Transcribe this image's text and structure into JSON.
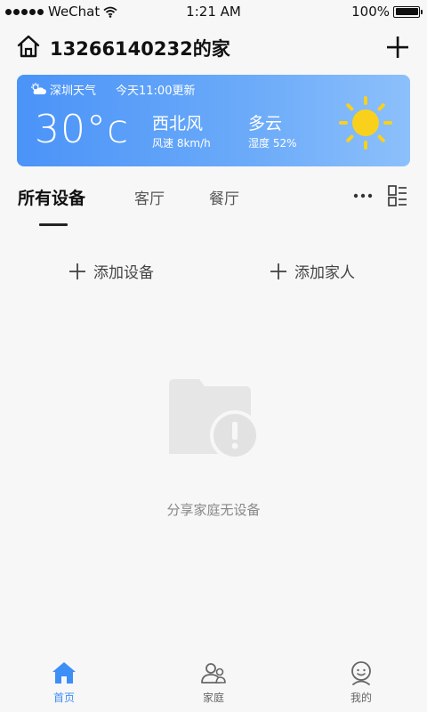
{
  "status_bar": {
    "carrier": "WeChat",
    "time": "1:21 AM",
    "battery_text": "100%",
    "icons": [
      "signal-dots-icon",
      "wifi-icon",
      "battery-icon"
    ]
  },
  "header": {
    "title": "13266140232的家",
    "home_icon": "home-icon",
    "add_icon": "plus-icon"
  },
  "weather": {
    "city_label": "深圳天气",
    "update_time": "今天11:00更新",
    "temperature": "30°c",
    "wind_direction": "西北风",
    "wind_speed": "风速 8km/h",
    "condition": "多云",
    "humidity": "湿度 52%",
    "icon": "sun-icon",
    "gradient_colors": [
      "#4a93f8",
      "#8cc0fb"
    ]
  },
  "tabs": {
    "items": [
      {
        "label": "所有设备",
        "active": true
      },
      {
        "label": "客厅",
        "active": false
      },
      {
        "label": "餐厅",
        "active": false
      }
    ],
    "more_icon": "more-dots-icon",
    "layout_icon": "grid-layout-icon"
  },
  "actions": {
    "add_device": "添加设备",
    "add_family": "添加家人"
  },
  "empty_state": {
    "message": "分享家庭无设备",
    "icon": "empty-folder-alert-icon"
  },
  "tabbar": {
    "items": [
      {
        "label": "首页",
        "icon": "home-icon",
        "active": true
      },
      {
        "label": "家庭",
        "icon": "family-icon",
        "active": false
      },
      {
        "label": "我的",
        "icon": "profile-icon",
        "active": false
      }
    ],
    "active_color": "#3e8ef7"
  }
}
